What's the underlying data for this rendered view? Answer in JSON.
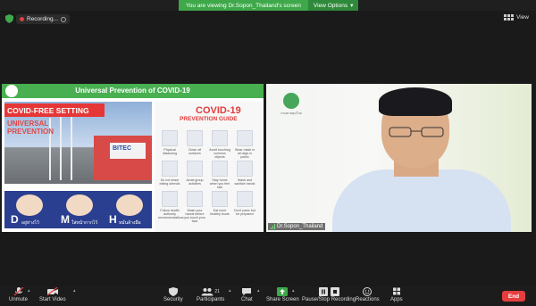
{
  "banner": {
    "message": "You are viewing Dr.Sopon_Thailand's screen",
    "options_label": "View Options"
  },
  "status": {
    "recording_label": "Recording..."
  },
  "view": {
    "label": "View"
  },
  "slide": {
    "title": "Universal Prevention of COVID-19",
    "headline": "COVID-FREE SETTING",
    "subheadline": "UNIVERSAL PREVENTION",
    "building_sign": "BITEC",
    "dmh": [
      {
        "letter": "D",
        "caption": "อยู่ห่างไว้"
      },
      {
        "letter": "M",
        "caption": "ใส่หน้ากากไว้"
      },
      {
        "letter": "H",
        "caption": "หมั่นล้างมือ"
      }
    ],
    "guide_title": "COVID-19",
    "guide_subtitle": "PREVENTION GUIDE",
    "guide_captions": [
      "Physical distancing",
      "Clean off surfaces",
      "Avoid touching common objects",
      "Wear mask in all days in public",
      "Do not share eating utensils",
      "Avoid group activities",
      "Stay home when you feel sick",
      "Wash and sanitize hands",
      "Follow health authority recommendations",
      "Wash your hands before you touch your face",
      "Eat more healthy foods",
      "Don't panic but be prepared"
    ]
  },
  "video": {
    "participant_name": "Dr.Sopon_Thailand",
    "ministry_caption": "กรมควบคุมโรค"
  },
  "toolbar": {
    "unmute": "Unmute",
    "start_video": "Start Video",
    "security": "Security",
    "participants": "Participants",
    "participants_count": "21",
    "chat": "Chat",
    "share_screen": "Share Screen",
    "pause_recording": "Pause/Stop Recording",
    "reactions": "Reactions",
    "apps": "Apps",
    "end": "End"
  },
  "colors": {
    "green": "#3ea84a",
    "end_red": "#e53e3e",
    "slide_green": "#48b050"
  }
}
